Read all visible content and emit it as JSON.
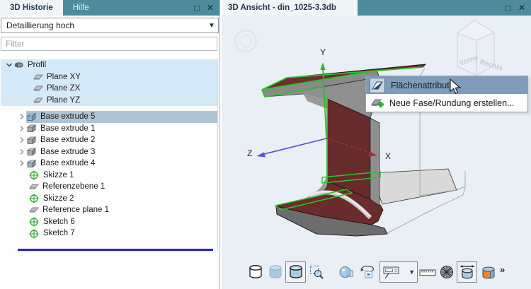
{
  "colors": {
    "teal_header": "#4E8C9D",
    "hover_blue": "#D5EAF8",
    "selection_row_blue": "#AEC5D5",
    "menu_highlight_blue": "#7F9DBA",
    "beam_red": "#6E2E2E",
    "selection_green": "#2EC22E",
    "insert_line_blue": "#2323CF",
    "axis_x_red": "#A03030",
    "axis_y_green": "#2DB82D",
    "axis_z_blue": "#5050E8",
    "solid_icon_orange": "#F0871E"
  },
  "left_panel": {
    "tabs": [
      {
        "label": "3D Historie"
      },
      {
        "label": "Hilfe"
      }
    ],
    "window_buttons": {
      "maximize": "□",
      "close": "✕"
    },
    "detail_dropdown": {
      "value": "Detaillierung hoch"
    },
    "filter": {
      "placeholder": "Filter"
    },
    "tree": [
      {
        "label": "Profil",
        "icon": "profile-icon",
        "expanded": true
      },
      {
        "label": "Plane XY",
        "icon": "plane-icon"
      },
      {
        "label": "Plane ZX",
        "icon": "plane-icon"
      },
      {
        "label": "Plane YZ",
        "icon": "plane-icon"
      },
      {
        "label": "Base extrude 5",
        "icon": "extrude-icon",
        "selected": true
      },
      {
        "label": "Base extrude 1",
        "icon": "extrude-icon"
      },
      {
        "label": "Base extrude 2",
        "icon": "extrude-icon"
      },
      {
        "label": "Base extrude 3",
        "icon": "extrude-icon"
      },
      {
        "label": "Base extrude 4",
        "icon": "extrude-icon"
      },
      {
        "label": "Skizze 1",
        "icon": "sketch-icon"
      },
      {
        "label": "Referenzebene 1",
        "icon": "plane-icon"
      },
      {
        "label": "Skizze 2",
        "icon": "sketch-icon"
      },
      {
        "label": "Reference plane 1",
        "icon": "plane-icon"
      },
      {
        "label": "Sketch 6",
        "icon": "sketch-icon"
      },
      {
        "label": "Sketch 7",
        "icon": "sketch-icon"
      }
    ]
  },
  "viewport": {
    "tab": {
      "label": "3D Ansicht - din_1025-3.3db"
    },
    "window_buttons": {
      "maximize": "□",
      "close": "✕"
    },
    "axes": {
      "x": "X",
      "y": "Y",
      "z": "Z"
    },
    "view_cube": {
      "front": "Vorne",
      "right": "Rechts"
    },
    "context_menu": {
      "items": [
        {
          "label": "Flächenattribute...",
          "icon": "face-attributes-icon",
          "highlighted": true
        },
        {
          "label": "Neue Fase/Rundung erstellen...",
          "icon": "new-chamfer-fillet-icon",
          "highlighted": false
        }
      ]
    },
    "toolbar": {
      "items": [
        "wireframe-view-icon",
        "shaded-view-icon",
        "shaded-edges-view-icon",
        "zoom-window-icon",
        "transparency-icon",
        "rotate-view-icon",
        "annotation-tool-icon",
        "ruler-icon",
        "mesh-view-icon",
        "measure-icon",
        "solid-view-icon"
      ],
      "more": "»"
    }
  }
}
